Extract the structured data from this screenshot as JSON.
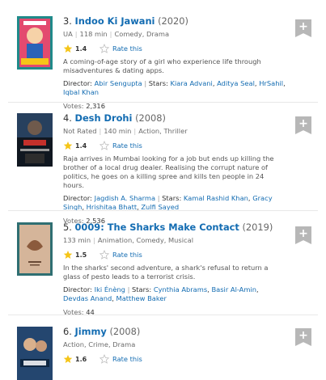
{
  "items": [
    {
      "number": "3.",
      "title": "Indoo Ki Jawani",
      "year": "(2020)",
      "certificate": "UA",
      "runtime": "118 min",
      "genre": "Comedy, Drama",
      "rating": "1.4",
      "rate_label": "Rate this",
      "description": "A coming-of-age story of a girl who experience life through misadventures & dating apps.",
      "director_label": "Director:",
      "directors": [
        "Abir Sengupta"
      ],
      "stars_label": "Stars:",
      "stars": [
        "Kiara Advani",
        "Aditya Seal",
        "HrSahil",
        "Iqbal Khan"
      ],
      "votes_label": "Votes:",
      "votes": "2,316"
    },
    {
      "number": "4.",
      "title": "Desh Drohi",
      "year": "(2008)",
      "certificate": "Not Rated",
      "runtime": "140 min",
      "genre": "Action, Thriller",
      "rating": "1.4",
      "rate_label": "Rate this",
      "description": "Raja arrives in Mumbai looking for a job but ends up killing the brother of a local drug dealer. Realising the corrupt nature of politics, he goes on a killing spree and kills ten people in 24 hours.",
      "director_label": "Director:",
      "directors": [
        "Jagdish A. Sharma"
      ],
      "stars_label": "Stars:",
      "stars": [
        "Kamal Rashid Khan",
        "Gracy Singh",
        "Hrishitaa Bhatt",
        "Zulfi Sayed"
      ],
      "votes_label": "Votes:",
      "votes": "2,536"
    },
    {
      "number": "5.",
      "title": "0009: The Sharks Make Contact",
      "year": "(2019)",
      "certificate": "",
      "runtime": "133 min",
      "genre": "Animation, Comedy, Musical",
      "rating": "1.5",
      "rate_label": "Rate this",
      "description": "In the sharks' second adventure, a shark's refusal to return a glass of pesto leads to a terrorist crisis.",
      "director_label": "Director:",
      "directors": [
        "Iki Énèng"
      ],
      "stars_label": "Stars:",
      "stars": [
        "Cynthia Abrams",
        "Basir Al-Amin",
        "Devdas Anand",
        "Matthew Baker"
      ],
      "votes_label": "Votes:",
      "votes": "44"
    },
    {
      "number": "6.",
      "title": "Jimmy",
      "year": "(2008)",
      "certificate": "",
      "runtime": "",
      "genre": "Action, Crime, Drama",
      "rating": "1.6",
      "rate_label": "Rate this",
      "description": "",
      "director_label": "",
      "directors": [],
      "stars_label": "",
      "stars": [],
      "votes_label": "",
      "votes": ""
    }
  ],
  "add_button_glyph": "+",
  "colors": {
    "link": "#136cb2",
    "star": "#f5c518",
    "add_button": "#b7b7b7"
  },
  "posters": [
    "poster-1",
    "poster-2",
    "poster-3",
    "poster-4"
  ]
}
